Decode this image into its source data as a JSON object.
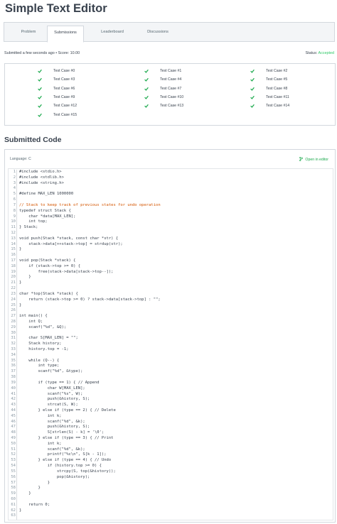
{
  "page": {
    "title": "Simple Text Editor"
  },
  "tabs": [
    {
      "label": "Problem"
    },
    {
      "label": "Submissions"
    },
    {
      "label": "Leaderboard"
    },
    {
      "label": "Discussions"
    }
  ],
  "submission": {
    "info": "Submitted a few seconds ago • Score: 10.00",
    "status_label": "Status:",
    "status_value": "Accepted"
  },
  "test_cases": [
    {
      "label": "Test Case #0",
      "status": "passed"
    },
    {
      "label": "Test Case #1",
      "status": "passed"
    },
    {
      "label": "Test Case #2",
      "status": "passed"
    },
    {
      "label": "Test Case #3",
      "status": "passed"
    },
    {
      "label": "Test Case #4",
      "status": "passed"
    },
    {
      "label": "Test Case #5",
      "status": "passed"
    },
    {
      "label": "Test Case #6",
      "status": "passed"
    },
    {
      "label": "Test Case #7",
      "status": "passed"
    },
    {
      "label": "Test Case #8",
      "status": "passed"
    },
    {
      "label": "Test Case #9",
      "status": "passed"
    },
    {
      "label": "Test Case #10",
      "status": "passed"
    },
    {
      "label": "Test Case #11",
      "status": "passed"
    },
    {
      "label": "Test Case #12",
      "status": "passed"
    },
    {
      "label": "Test Case #13",
      "status": "passed"
    },
    {
      "label": "Test Case #14",
      "status": "passed"
    },
    {
      "label": "Test Case #15",
      "status": "passed"
    }
  ],
  "code_section": {
    "title": "Submitted Code",
    "language": "Language: C",
    "open_in_editor": "Open in editor",
    "lines": [
      "#include <stdio.h>",
      "#include <stdlib.h>",
      "#include <string.h>",
      "",
      "#define MAX_LEN 1000000",
      "",
      "// Stack to keep track of previous states for undo operation",
      "typedef struct Stack {",
      "    char *data[MAX_LEN];",
      "    int top;",
      "} Stack;",
      "",
      "void push(Stack *stack, const char *str) {",
      "    stack->data[++stack->top] = strdup(str);",
      "}",
      "",
      "void pop(Stack *stack) {",
      "    if (stack->top >= 0) {",
      "        free(stack->data[stack->top--]);",
      "    }",
      "}",
      "",
      "char *top(Stack *stack) {",
      "    return (stack->top >= 0) ? stack->data[stack->top] : \"\";",
      "}",
      "",
      "int main() {",
      "    int Q;",
      "    scanf(\"%d\", &Q);",
      "",
      "    char S[MAX_LEN] = \"\";",
      "    Stack history;",
      "    history.top = -1;",
      "",
      "    while (Q--) {",
      "        int type;",
      "        scanf(\"%d\", &type);",
      "",
      "        if (type == 1) { // Append",
      "            char W[MAX_LEN];",
      "            scanf(\"%s\", W);",
      "            push(&history, S);",
      "            strcat(S, W);",
      "        } else if (type == 2) { // Delete",
      "            int k;",
      "            scanf(\"%d\", &k);",
      "            push(&history, S);",
      "            S[strlen(S) - k] = '\\0';",
      "        } else if (type == 3) { // Print",
      "            int k;",
      "            scanf(\"%d\", &k);",
      "            printf(\"%c\\n\", S[k - 1]);",
      "        } else if (type == 4) { // Undo",
      "            if (history.top >= 0) {",
      "                strcpy(S, top(&history));",
      "                pop(&history);",
      "            }",
      "        }",
      "    }",
      "",
      "    return 0;",
      "}",
      ""
    ]
  },
  "colors": {
    "accent_green": "#2ec866",
    "check_green": "#1ba94c",
    "comment": "#d45500",
    "text": "#39424e"
  }
}
